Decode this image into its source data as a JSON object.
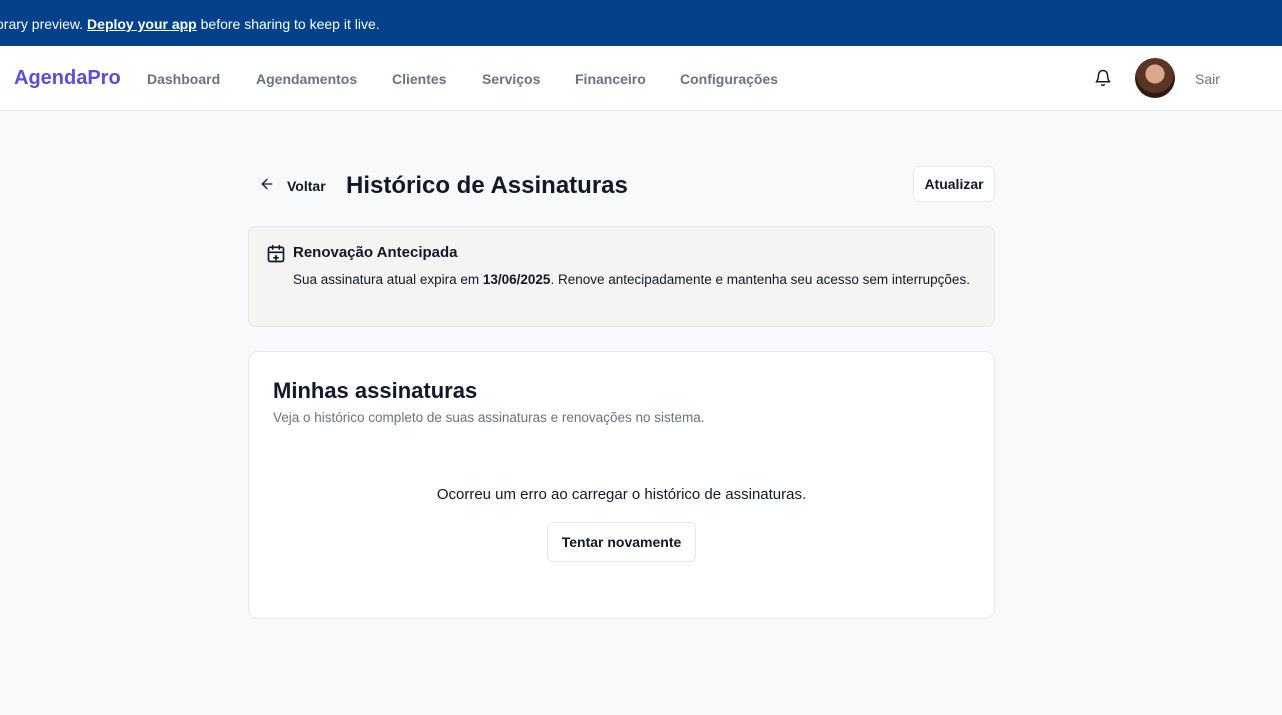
{
  "banner": {
    "prefix": "orary preview. ",
    "link_text": "Deploy your app",
    "suffix": " before sharing to keep it live."
  },
  "navbar": {
    "logo": "AgendaPro",
    "items": [
      "Dashboard",
      "Agendamentos",
      "Clientes",
      "Serviços",
      "Financeiro",
      "Configurações"
    ],
    "logout": "Sair",
    "bell_icon": "bell-icon",
    "avatar": "user-avatar"
  },
  "header": {
    "back_label": "Voltar",
    "title": "Histórico de Assinaturas",
    "refresh_label": "Atualizar"
  },
  "alert": {
    "icon": "calendar-plus-icon",
    "title": "Renovação Antecipada",
    "text_prefix": "Sua assinatura atual expira em ",
    "date": "13/06/2025",
    "text_suffix": ". Renove antecipadamente e mantenha seu acesso sem interrupções."
  },
  "card": {
    "title": "Minhas assinaturas",
    "subtitle": "Veja o histórico completo de suas assinaturas e renovações no sistema.",
    "error_message": "Ocorreu um erro ao carregar o histórico de assinaturas.",
    "retry_label": "Tentar novamente"
  },
  "colors": {
    "banner_bg": "#03428a",
    "brand": "#5b4ddb",
    "alert_bg": "#f4f4f2"
  }
}
